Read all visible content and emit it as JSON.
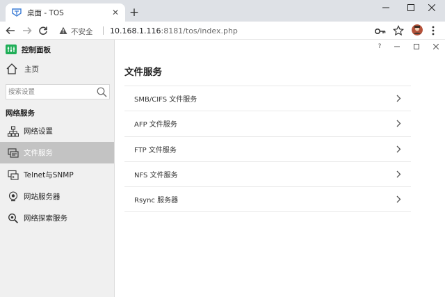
{
  "browser": {
    "tab_title": "桌面 - TOS",
    "new_tab": "+",
    "close_tab": "✕",
    "insecure_label": "不安全",
    "url_host": "10.168.1.116",
    "url_rest": ":8181/tos/index.php"
  },
  "window_controls": {
    "minimize": "—",
    "maximize": "☐",
    "close": "✕"
  },
  "sidebar": {
    "title": "控制面板",
    "home_label": "主页",
    "search_placeholder": "搜索设置",
    "section_title": "网络服务",
    "items": [
      {
        "label": "网络设置",
        "icon": "network-icon"
      },
      {
        "label": "文件服务",
        "icon": "file-service-icon",
        "active": true
      },
      {
        "label": "Telnet与SNMP",
        "icon": "terminal-icon"
      },
      {
        "label": "网站服务器",
        "icon": "web-server-icon"
      },
      {
        "label": "网络探索服务",
        "icon": "discovery-icon"
      }
    ]
  },
  "main": {
    "controls": {
      "help": "?",
      "minimize": "—",
      "maximize": "☐",
      "close": "✕"
    },
    "title": "文件服务",
    "services": [
      {
        "label": "SMB/CIFS 文件服务"
      },
      {
        "label": "AFP 文件服务"
      },
      {
        "label": "FTP 文件服务"
      },
      {
        "label": "NFS 文件服务"
      },
      {
        "label": "Rsync 服务器"
      }
    ]
  },
  "colors": {
    "tabstrip_bg": "#dee1e6",
    "sidebar_bg": "#f0f0f0",
    "active_item_bg": "#c3c3c3",
    "logo_green": "#1fae57"
  }
}
